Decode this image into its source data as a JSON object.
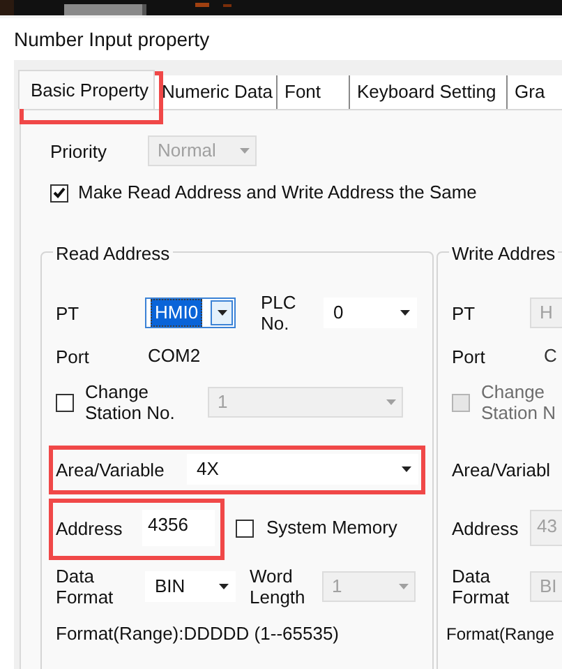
{
  "window": {
    "title": "Number Input property"
  },
  "tabs": [
    {
      "label": "Basic Property",
      "selected": true
    },
    {
      "label": "Numeric Data",
      "selected": false
    },
    {
      "label": "Font",
      "selected": false
    },
    {
      "label": "Keyboard Setting",
      "selected": false
    },
    {
      "label": "Gra",
      "selected": false
    }
  ],
  "priority": {
    "label": "Priority",
    "value": "Normal",
    "disabled": true
  },
  "same_address": {
    "label": "Make Read Address and Write Address the Same",
    "checked": true
  },
  "read_address": {
    "title": "Read Address",
    "disabled": false,
    "pt": {
      "label": "PT",
      "value": "HMI0",
      "focused": true
    },
    "plc_no": {
      "label": "PLC No.",
      "value": "0"
    },
    "port": {
      "label": "Port",
      "value": "COM2"
    },
    "change_station": {
      "label": "Change Station No.",
      "checked": false,
      "value": "1",
      "disabled": true
    },
    "area": {
      "label": "Area/Variable",
      "value": "4X"
    },
    "address": {
      "label": "Address",
      "value": "4356"
    },
    "system_memory": {
      "label": "System Memory",
      "checked": false
    },
    "data_format": {
      "label": "Data Format",
      "value": "BIN"
    },
    "word_length": {
      "label": "Word Length",
      "value": "1",
      "disabled": true
    },
    "format_range": "Format(Range):DDDDD (1--65535)"
  },
  "write_address": {
    "title": "Write Addres",
    "disabled": true,
    "pt": {
      "label": "PT",
      "value": "H"
    },
    "port": {
      "label": "Port",
      "value": "C"
    },
    "change_station": {
      "label": "Change Station N",
      "checked": false
    },
    "area": {
      "label": "Area/Variabl"
    },
    "address": {
      "label": "Address",
      "value": "43"
    },
    "data_format": {
      "label": "Data Format",
      "value": "BI"
    },
    "format_range": "Format(Range"
  }
}
